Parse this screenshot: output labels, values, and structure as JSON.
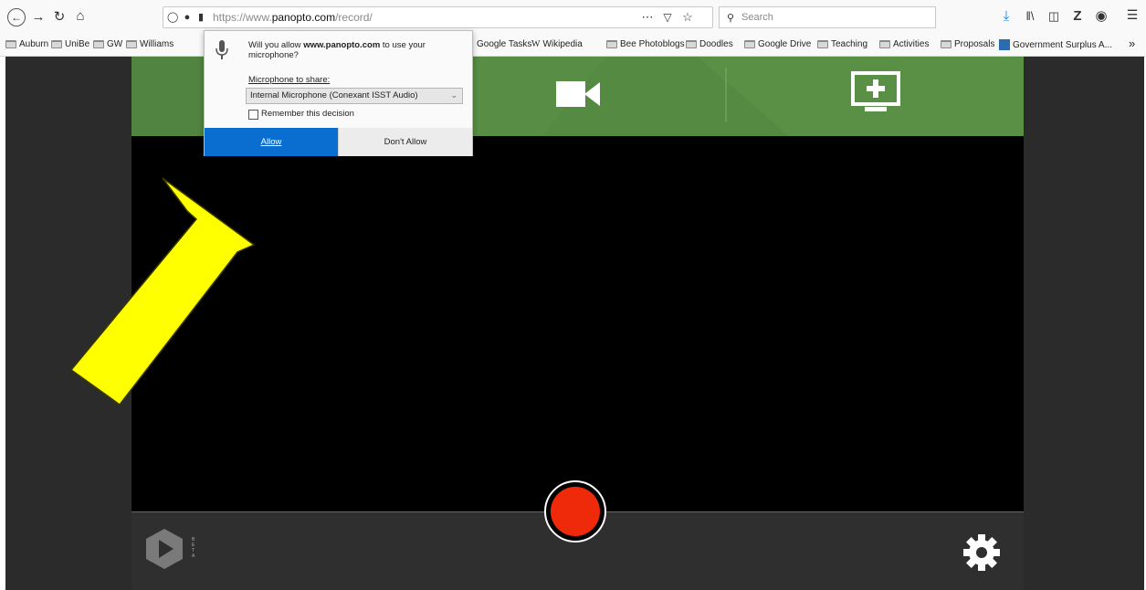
{
  "browser": {
    "url_prefix": "https://www.",
    "url_host": "panopto.com",
    "url_path": "/record/",
    "url_overflow": "⋯",
    "search_placeholder": "Search"
  },
  "bookmarks": [
    {
      "label": "Auburn",
      "type": "folder"
    },
    {
      "label": "UniBe",
      "type": "folder"
    },
    {
      "label": "GW",
      "type": "folder"
    },
    {
      "label": "Williams",
      "type": "folder"
    },
    {
      "label": "Google Tasks",
      "type": "link"
    },
    {
      "label": "Wikipedia",
      "type": "link",
      "prefix": "W"
    },
    {
      "label": "Bee Photoblogs",
      "type": "folder"
    },
    {
      "label": "Doodles",
      "type": "folder"
    },
    {
      "label": "Google Drive",
      "type": "folder"
    },
    {
      "label": "Teaching",
      "type": "folder"
    },
    {
      "label": "Activities",
      "type": "folder"
    },
    {
      "label": "Proposals",
      "type": "folder"
    },
    {
      "label": "Government Surplus A...",
      "type": "link"
    }
  ],
  "bookmarks_overflow": "»",
  "permission_dialog": {
    "question_pre": "Will you allow ",
    "question_host": "www.panopto.com",
    "question_post": " to use your microphone?",
    "device_label": "Microphone to share:",
    "device_selected": "Internal Microphone (Conexant ISST Audio)",
    "remember_label": "Remember this decision",
    "remember_checked": false,
    "allow_label": "Allow",
    "deny_label": "Don't Allow"
  },
  "panopto": {
    "badge_text": "BETA"
  },
  "colors": {
    "header_green": "#558a42",
    "record_red": "#ee2a0b",
    "allow_blue": "#0a6ed1",
    "arrow_yellow": "#ffff00"
  },
  "icons": [
    "back-icon",
    "forward-icon",
    "reload-icon",
    "home-icon",
    "shield-icon",
    "lock-icon",
    "microphone-icon",
    "pocket-icon",
    "star-icon",
    "search-icon",
    "download-icon",
    "library-icon",
    "sidebar-icon",
    "zotero-icon",
    "extension-icon",
    "menu-icon",
    "webcam-icon",
    "screen-add-icon",
    "panopto-logo",
    "settings-gear-icon",
    "record-icon"
  ]
}
